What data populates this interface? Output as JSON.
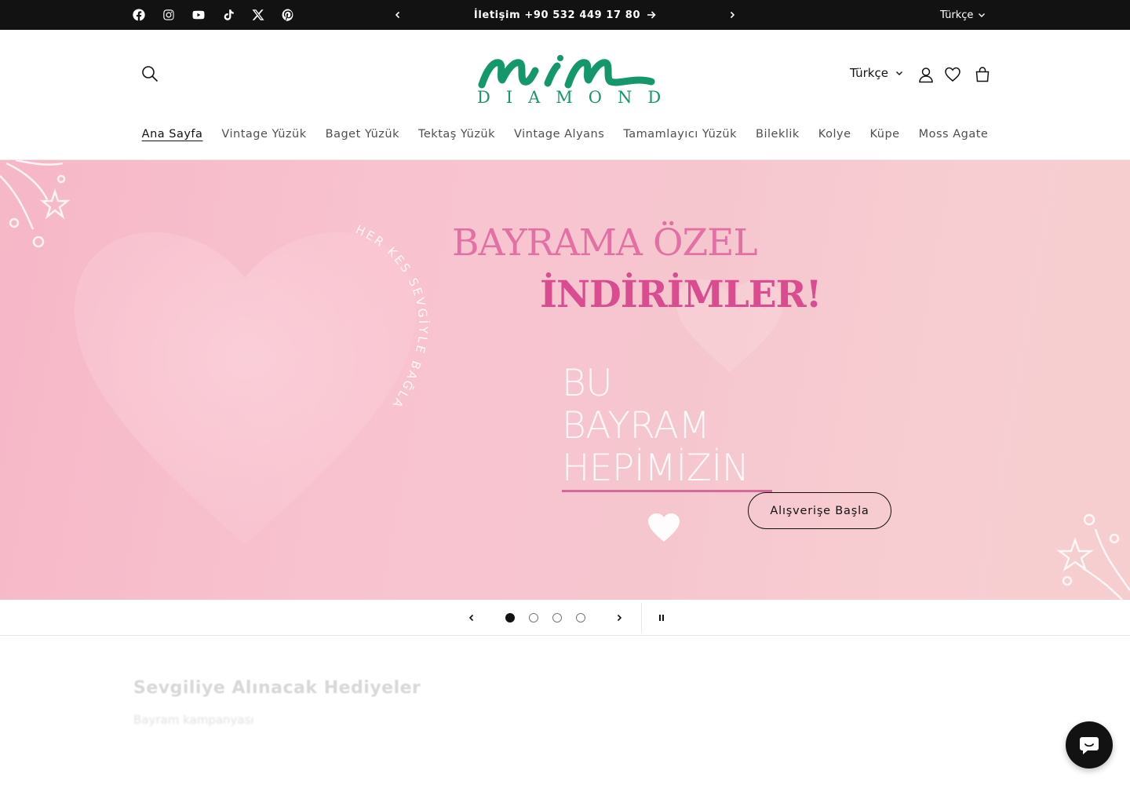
{
  "announcement": {
    "text": "İletişim +90 532 449 17 80",
    "language": "Türkçe",
    "social_icons": [
      "facebook-icon",
      "instagram-icon",
      "youtube-icon",
      "tiktok-icon",
      "x-icon",
      "pinterest-icon"
    ]
  },
  "header": {
    "logo_word": "mim",
    "logo_sub": "DIAMOND",
    "language": "Türkçe",
    "brand_color": "#14976b"
  },
  "nav": {
    "items": [
      {
        "label": "Ana Sayfa",
        "active": true
      },
      {
        "label": "Vintage Yüzük"
      },
      {
        "label": "Baget Yüzük"
      },
      {
        "label": "Tektaş Yüzük"
      },
      {
        "label": "Vintage Alyans"
      },
      {
        "label": "Tamamlayıcı Yüzük"
      },
      {
        "label": "Bileklik"
      },
      {
        "label": "Kolye"
      },
      {
        "label": "Küpe"
      },
      {
        "label": "Moss Agate"
      }
    ]
  },
  "hero": {
    "title_line1": "BAYRAMA ÖZEL",
    "title_line2": "İNDİRİMLER!",
    "sub_line1": "BU",
    "sub_line2": "BAYRAM",
    "sub_line3": "HEPİMİZİN",
    "heart_text": "HER KES SEVGİYLE BAĞLANSIN",
    "button_label": "Alışverişe Başla",
    "background_color": "#f8c3cf",
    "accent_color": "#e370a4"
  },
  "slider": {
    "slide_count": 4,
    "active_index": 0
  },
  "section": {
    "title": "Sevgiliye Alınacak Hediyeler",
    "subtitle": "Bayram kampanyası"
  }
}
